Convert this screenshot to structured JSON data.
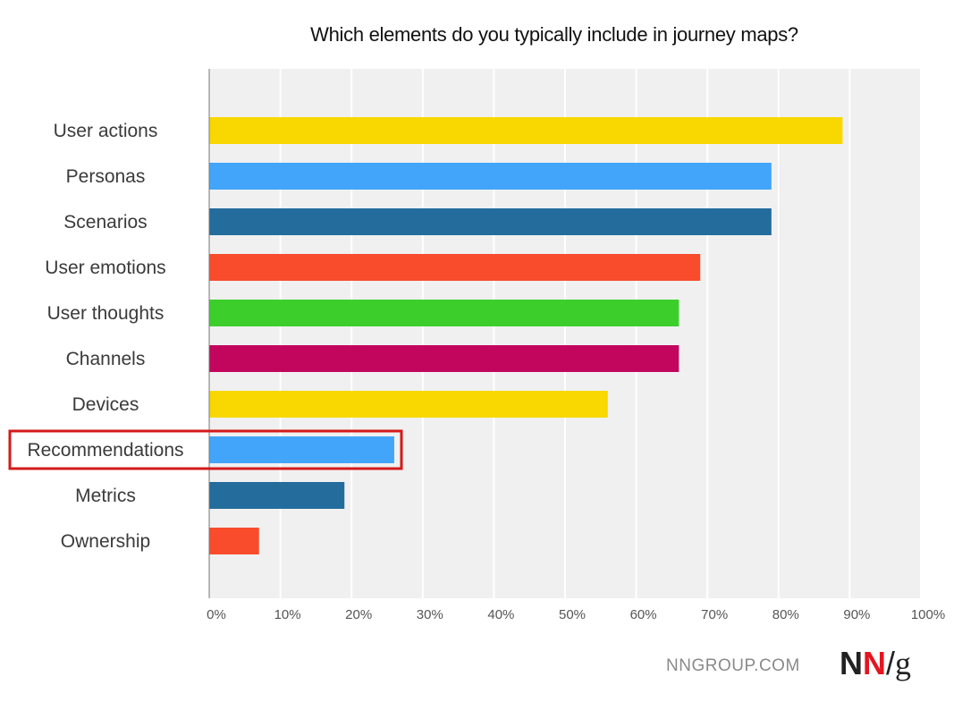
{
  "chart_data": {
    "type": "bar",
    "orientation": "horizontal",
    "title": "Which elements do you typically include in journey maps?",
    "xlabel": "",
    "ylabel": "",
    "xlim": [
      0,
      100
    ],
    "x_tick_labels": [
      "0%",
      "10%",
      "20%",
      "30%",
      "40%",
      "50%",
      "60%",
      "70%",
      "80%",
      "90%",
      "100%"
    ],
    "grid": true,
    "categories": [
      "User actions",
      "Personas",
      "Scenarios",
      "User emotions",
      "User thoughts",
      "Channels",
      "Devices",
      "Recommendations",
      "Metrics",
      "Ownership"
    ],
    "values": [
      89,
      79,
      79,
      69,
      66,
      66,
      56,
      26,
      19,
      7
    ],
    "colors": [
      "#f8d800",
      "#42a5fa",
      "#246c9c",
      "#f84c2c",
      "#3ccf2c",
      "#c2065e",
      "#f8d800",
      "#42a5fa",
      "#246c9c",
      "#f84c2c"
    ],
    "highlighted_category": "Recommendations",
    "highlight_color": "#d41a1a"
  },
  "footer": {
    "site": "NNGROUP.COM",
    "logo_n1": "N",
    "logo_n2": "N",
    "logo_slash": "/",
    "logo_g": "g"
  }
}
